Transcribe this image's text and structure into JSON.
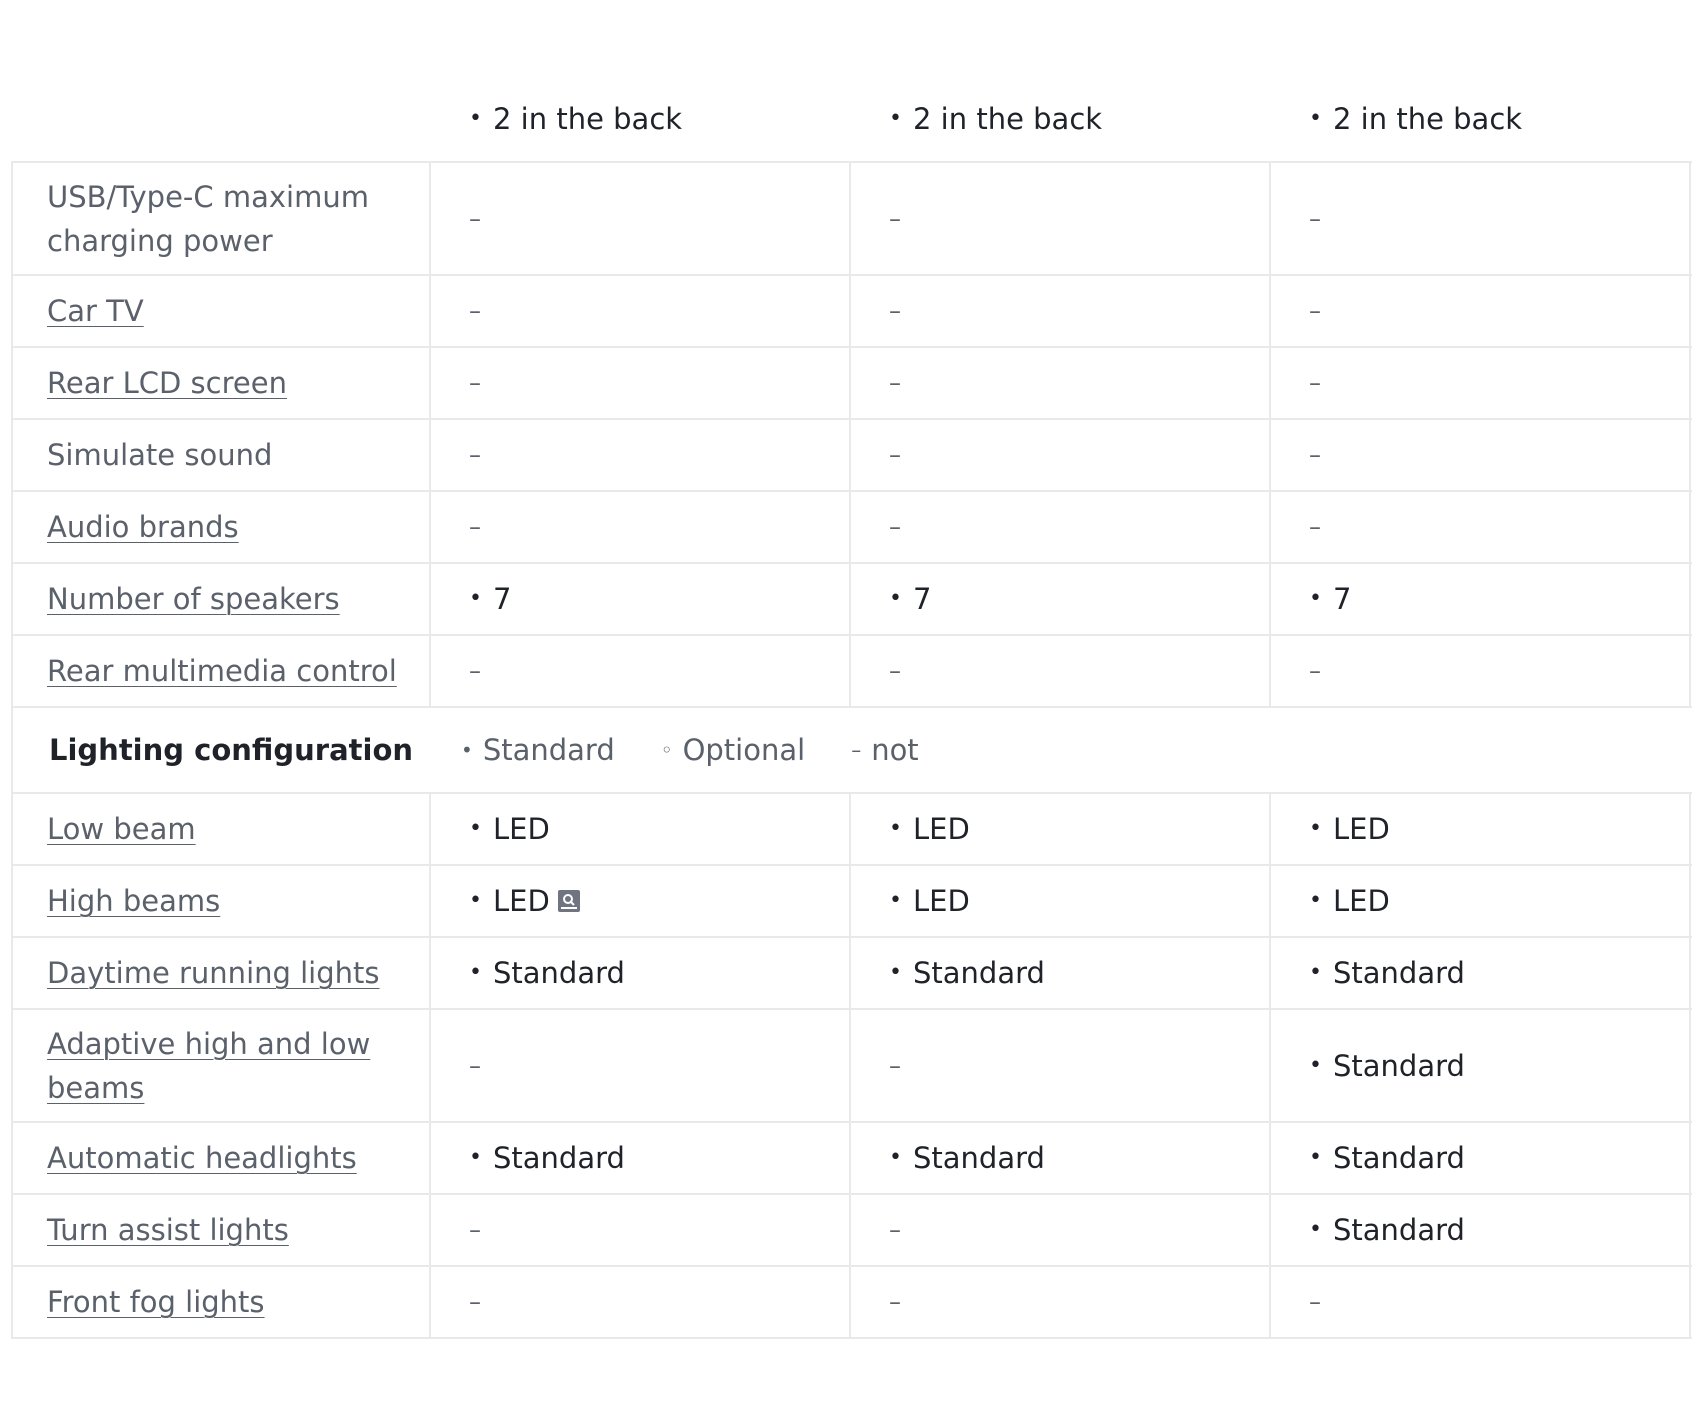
{
  "header_row": {
    "values": [
      "2 in the back",
      "2 in the back",
      "2 in the back"
    ]
  },
  "multimedia_rows": [
    {
      "label": "USB/Type-C maximum charging power",
      "is_link": false,
      "tall": true,
      "values": [
        {
          "type": "dash",
          "text": "–"
        },
        {
          "type": "dash",
          "text": "–"
        },
        {
          "type": "dash",
          "text": "–"
        }
      ]
    },
    {
      "label": "Car TV",
      "is_link": true,
      "tall": false,
      "values": [
        {
          "type": "dash",
          "text": "–"
        },
        {
          "type": "dash",
          "text": "–"
        },
        {
          "type": "dash",
          "text": "–"
        }
      ]
    },
    {
      "label": "Rear LCD screen",
      "is_link": true,
      "tall": false,
      "values": [
        {
          "type": "dash",
          "text": "–"
        },
        {
          "type": "dash",
          "text": "–"
        },
        {
          "type": "dash",
          "text": "–"
        }
      ]
    },
    {
      "label": "Simulate sound",
      "is_link": false,
      "tall": false,
      "values": [
        {
          "type": "dash",
          "text": "–"
        },
        {
          "type": "dash",
          "text": "–"
        },
        {
          "type": "dash",
          "text": "–"
        }
      ]
    },
    {
      "label": "Audio brands",
      "is_link": true,
      "tall": false,
      "values": [
        {
          "type": "dash",
          "text": "–"
        },
        {
          "type": "dash",
          "text": "–"
        },
        {
          "type": "dash",
          "text": "–"
        }
      ]
    },
    {
      "label": "Number of speakers",
      "is_link": true,
      "tall": false,
      "values": [
        {
          "type": "std",
          "text": "7"
        },
        {
          "type": "std",
          "text": "7"
        },
        {
          "type": "std",
          "text": "7"
        }
      ]
    },
    {
      "label": "Rear multimedia control",
      "is_link": true,
      "tall": false,
      "values": [
        {
          "type": "dash",
          "text": "–"
        },
        {
          "type": "dash",
          "text": "–"
        },
        {
          "type": "dash",
          "text": "–"
        }
      ]
    }
  ],
  "section": {
    "title": "Lighting configuration",
    "legend": [
      {
        "mark": "•",
        "text": "Standard"
      },
      {
        "mark": "◦",
        "text": "Optional"
      },
      {
        "mark": "–",
        "text": "not"
      }
    ]
  },
  "lighting_rows": [
    {
      "label": "Low beam",
      "is_link": true,
      "tall": false,
      "values": [
        {
          "type": "std",
          "text": "LED"
        },
        {
          "type": "std",
          "text": "LED"
        },
        {
          "type": "std",
          "text": "LED"
        }
      ]
    },
    {
      "label": "High beams",
      "is_link": true,
      "tall": false,
      "values": [
        {
          "type": "std",
          "text": "LED",
          "icon": "search-icon"
        },
        {
          "type": "std",
          "text": "LED"
        },
        {
          "type": "std",
          "text": "LED"
        }
      ]
    },
    {
      "label": "Daytime running lights",
      "is_link": true,
      "tall": false,
      "values": [
        {
          "type": "std",
          "text": "Standard"
        },
        {
          "type": "std",
          "text": "Standard"
        },
        {
          "type": "std",
          "text": "Standard"
        }
      ]
    },
    {
      "label": "Adaptive high and low beams",
      "is_link": true,
      "tall": true,
      "values": [
        {
          "type": "dash",
          "text": "–"
        },
        {
          "type": "dash",
          "text": "–"
        },
        {
          "type": "std",
          "text": "Standard"
        }
      ]
    },
    {
      "label": "Automatic headlights",
      "is_link": true,
      "tall": false,
      "values": [
        {
          "type": "std",
          "text": "Standard"
        },
        {
          "type": "std",
          "text": "Standard"
        },
        {
          "type": "std",
          "text": "Standard"
        }
      ]
    },
    {
      "label": "Turn assist lights",
      "is_link": true,
      "tall": false,
      "values": [
        {
          "type": "dash",
          "text": "–"
        },
        {
          "type": "dash",
          "text": "–"
        },
        {
          "type": "std",
          "text": "Standard"
        }
      ]
    },
    {
      "label": "Front fog lights",
      "is_link": true,
      "tall": false,
      "values": [
        {
          "type": "dash",
          "text": "–"
        },
        {
          "type": "dash",
          "text": "–"
        },
        {
          "type": "dash",
          "text": "–"
        }
      ]
    }
  ],
  "bullet_mark": "•",
  "colors": {
    "text": "#1f2329",
    "muted": "#5b616b",
    "border": "#e8e9eb",
    "icon": "#6f7480"
  }
}
